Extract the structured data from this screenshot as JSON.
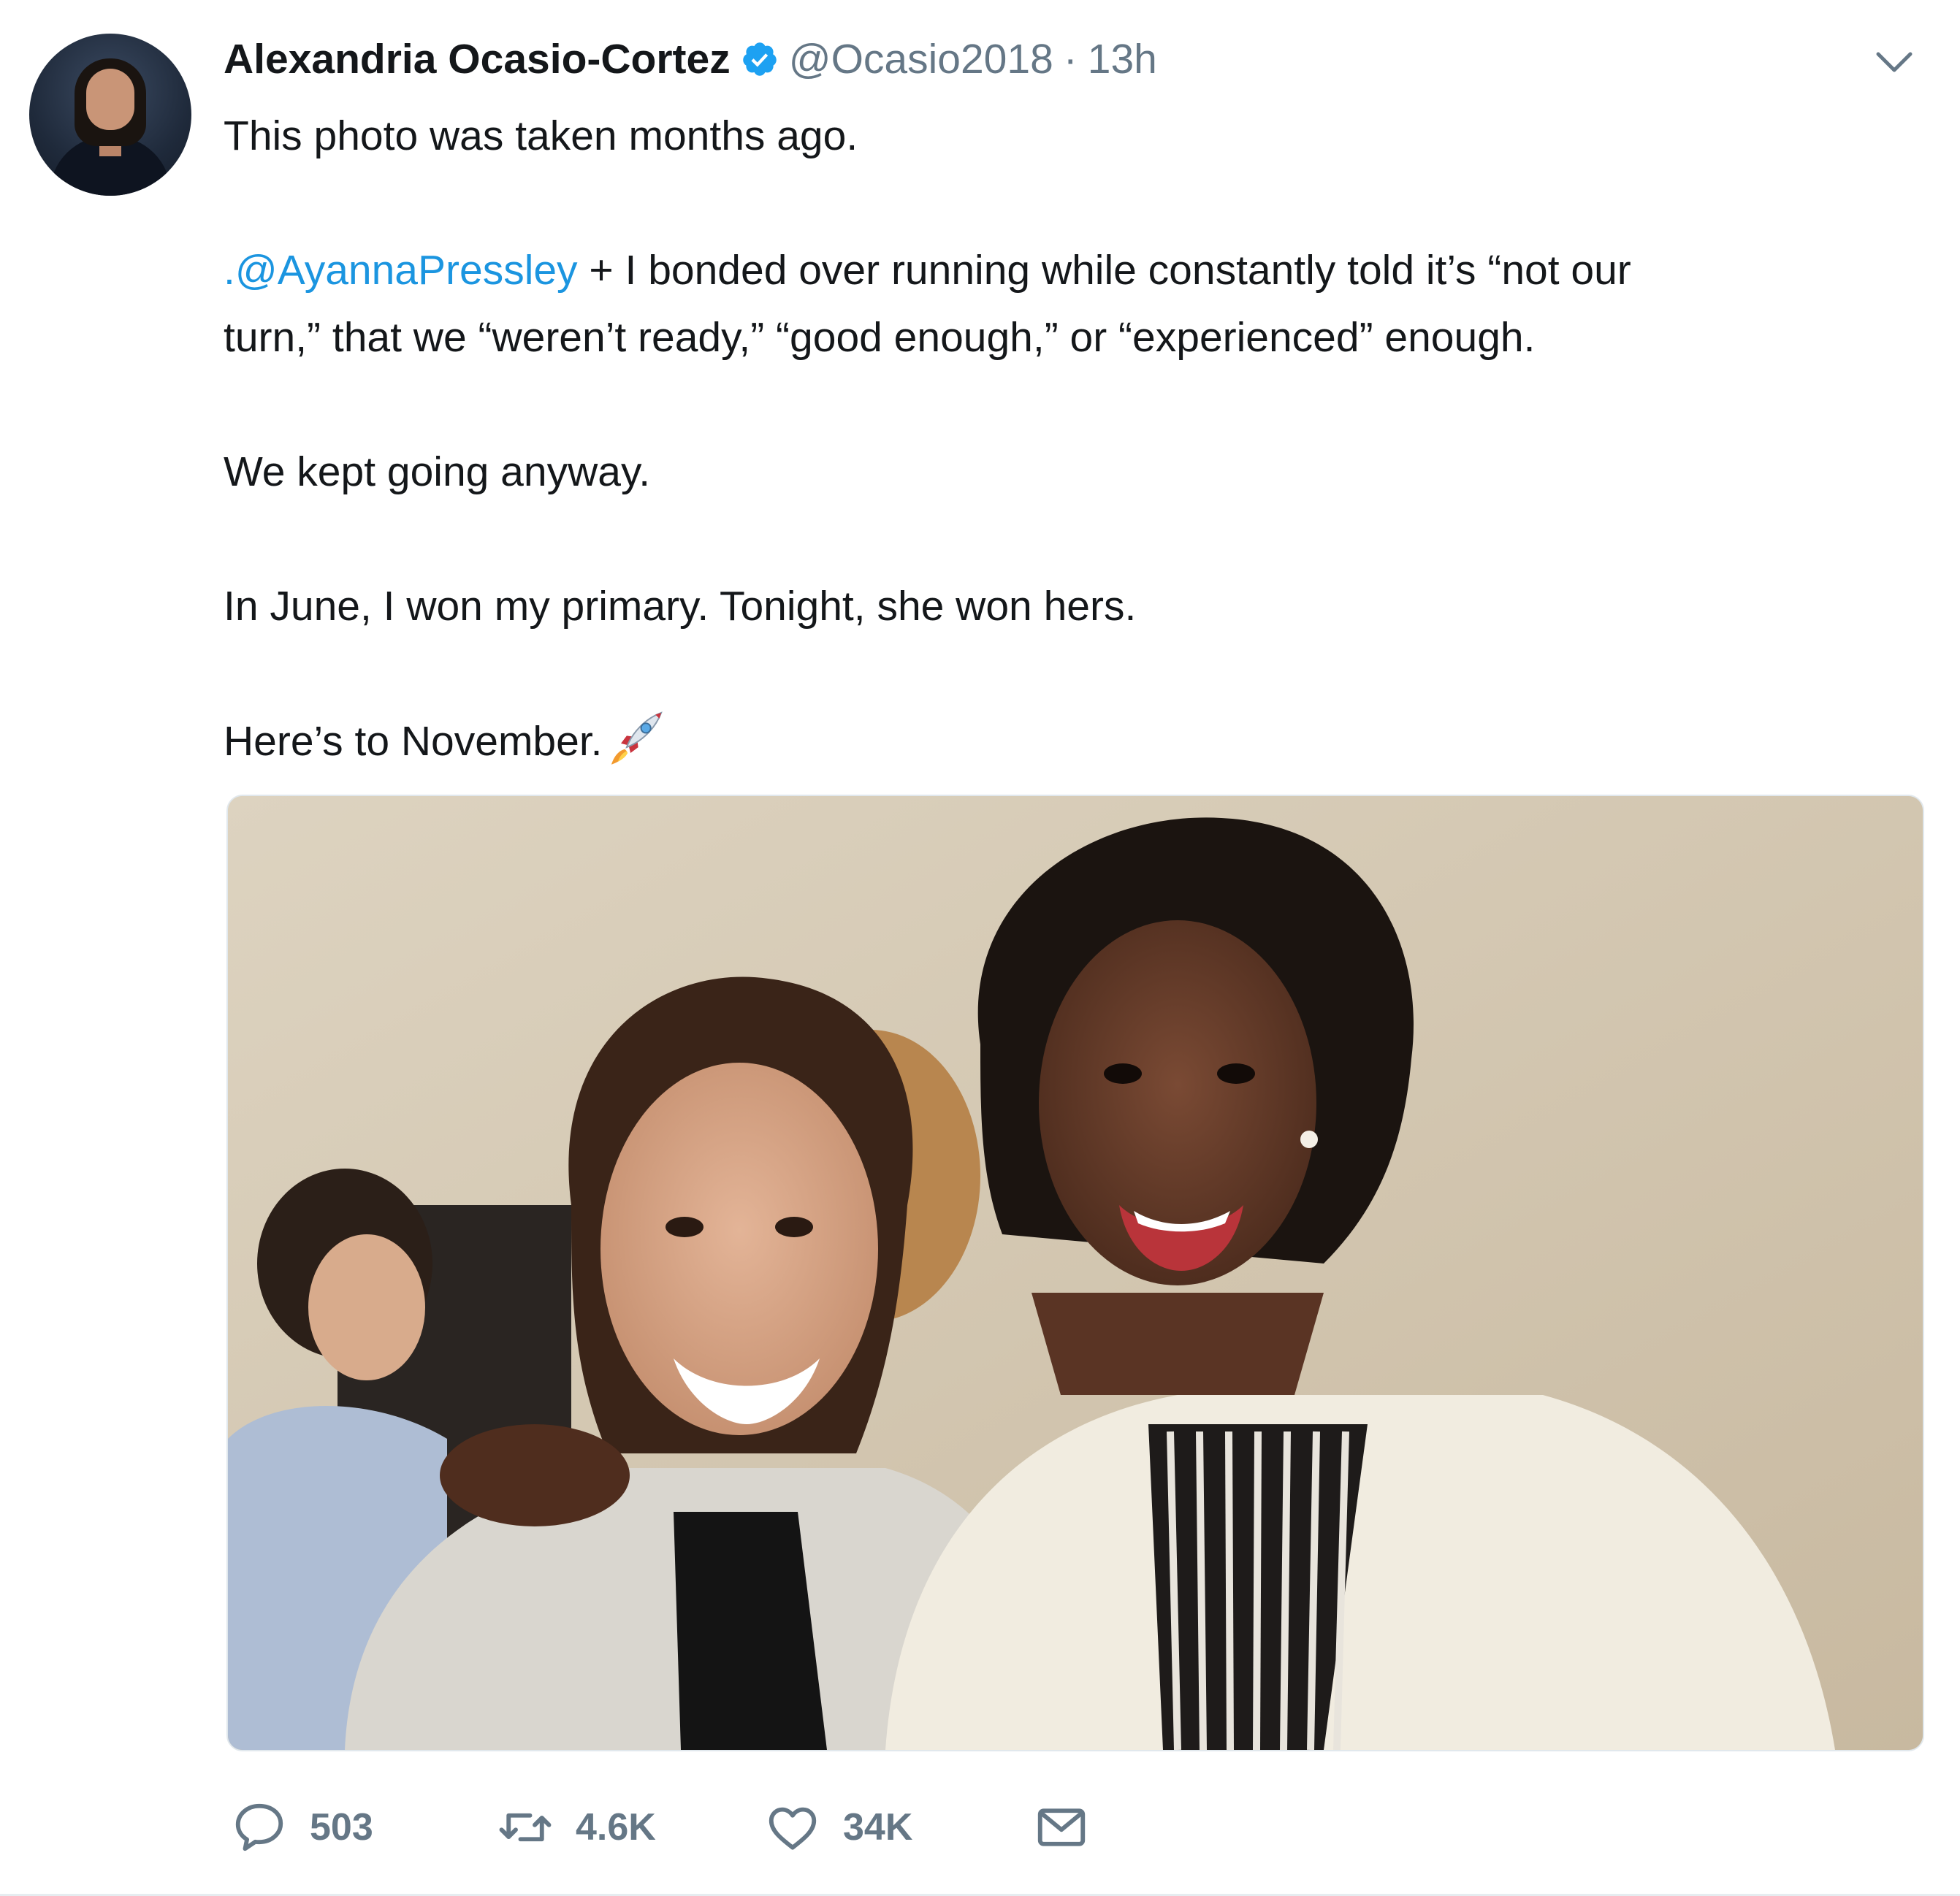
{
  "tweet": {
    "author_name": "Alexandria Ocasio-Cortez",
    "handle": "@Ocasio2018",
    "separator": "·",
    "time": "13h",
    "lines": {
      "line1": "This photo was taken months ago.",
      "line2_mention": ".@AyannaPressley",
      "line2_rest": " + I bonded over running while constantly told it’s “not our",
      "line3": "turn,” that we “weren’t ready,” “good enough,” or “experienced” enough.",
      "line4": "We kept going anyway.",
      "line5": "In June, I won my primary. Tonight, she won hers.",
      "line6": "Here’s to November."
    },
    "emoji": "rocket-emoji"
  },
  "actions": {
    "reply_count": "503",
    "retweet_count": "4.6K",
    "like_count": "34K"
  },
  "colors": {
    "text": "#14171a",
    "muted": "#657786",
    "link": "#1b95e0",
    "verified": "#1da1f2",
    "divider": "#e6ecf0"
  },
  "icons": [
    "avatar",
    "verified-badge-icon",
    "chevron-down-icon",
    "rocket-icon",
    "reply-icon",
    "retweet-icon",
    "like-icon",
    "direct-message-icon"
  ]
}
